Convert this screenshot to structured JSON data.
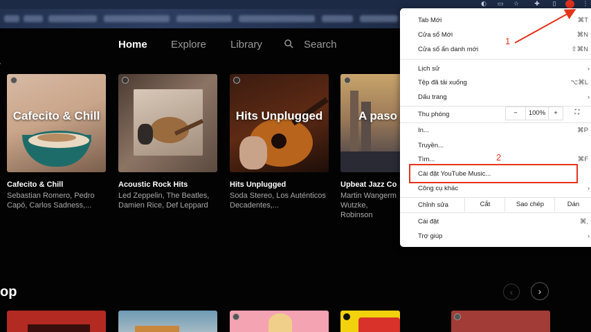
{
  "browser": {
    "toolbar_icons": [
      "google-account-icon",
      "cast-icon",
      "bookmark-star-icon",
      "extensions-puzzle-icon",
      "sidepanel-icon",
      "profile-avatar",
      "chrome-menu-kebab-icon"
    ],
    "colors": {
      "toolbar": "#1c2a45",
      "profile": "#e0301e"
    }
  },
  "nav": {
    "home": "Home",
    "explore": "Explore",
    "library": "Library",
    "search": "Search"
  },
  "cards": [
    {
      "thumb_text": "Cafecito & Chill",
      "title": "Cafecito & Chill",
      "subtitle": "Sebastian Romero, Pedro Capó, Carlos Sadness,..."
    },
    {
      "thumb_text": "",
      "title": "Acoustic Rock Hits",
      "subtitle": "Led Zeppelin, The Beatles, Damien Rice, Def Leppard"
    },
    {
      "thumb_text": "Hits Unplugged",
      "title": "Hits Unplugged",
      "subtitle": "Soda Stereo, Los Auténticos Decadentes,..."
    },
    {
      "thumb_text": "A paso jazz",
      "title": "Upbeat Jazz Co",
      "subtitle": "Martin Wangerm Wutzke, Robinson"
    }
  ],
  "section_title": "op",
  "menu": {
    "new_tab": {
      "label": "Tab Mới",
      "shortcut": "⌘T"
    },
    "new_window": {
      "label": "Cửa sổ Mới",
      "shortcut": "⌘N"
    },
    "incognito": {
      "label": "Cửa sổ ẩn danh mới",
      "shortcut": "⇧⌘N"
    },
    "history": {
      "label": "Lịch sử"
    },
    "downloads": {
      "label": "Tệp đã tải xuống",
      "shortcut": "⌥⌘L"
    },
    "bookmarks": {
      "label": "Dấu trang"
    },
    "zoom": {
      "label": "Thu phóng",
      "minus": "−",
      "value": "100%",
      "plus": "+"
    },
    "print": {
      "label": "In...",
      "shortcut": "⌘P"
    },
    "cast": {
      "label": "Truyền..."
    },
    "find": {
      "label": "Tìm...",
      "shortcut": "⌘F"
    },
    "install": {
      "label": "Cài đặt YouTube Music..."
    },
    "more_tools": {
      "label": "Công cụ khác"
    },
    "edit": {
      "label": "Chỉnh sửa",
      "cut": "Cắt",
      "copy": "Sao chép",
      "paste": "Dán"
    },
    "settings": {
      "label": "Cài đặt",
      "shortcut": "⌘,"
    },
    "help": {
      "label": "Trợ giúp"
    }
  },
  "annotations": {
    "one": "1",
    "two": "2",
    "color": "#e5331a"
  }
}
